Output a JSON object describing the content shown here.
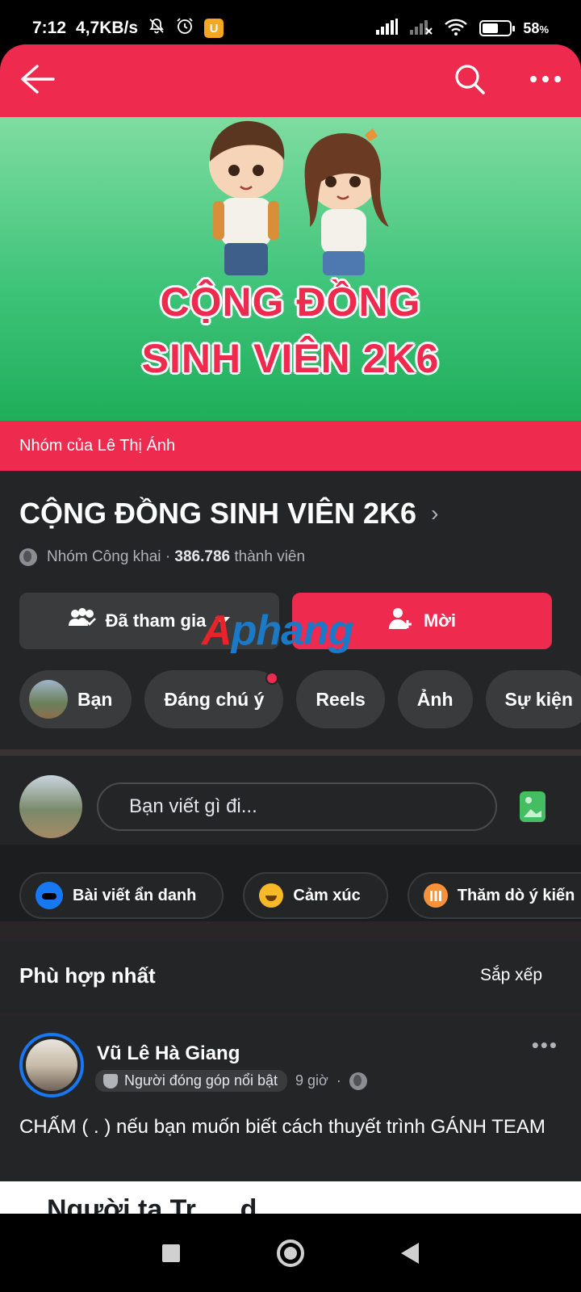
{
  "status_bar": {
    "time": "7:12",
    "speed": "4,7KB/s",
    "battery_percent": "58",
    "battery_unit": "%",
    "battery_level": 0.58,
    "icons": [
      "mute-bell-icon",
      "alarm-icon",
      "app-badge-icon",
      "signal-icon",
      "signal-off-icon",
      "wifi-icon",
      "battery-icon"
    ]
  },
  "header": {
    "back_icon": "arrow-left-icon",
    "search_icon": "search-icon",
    "more_icon": "more-horizontal-icon",
    "accent_color": "#ee2a4e"
  },
  "cover": {
    "line1": "CỘNG ĐỒNG",
    "line2": "SINH VIÊN 2K6"
  },
  "group": {
    "owner_label": "Nhóm của Lê Thị Ánh",
    "name": "CỘNG ĐỒNG SINH VIÊN 2K6",
    "privacy": "Nhóm Công khai",
    "separator": "·",
    "member_count": "386.786",
    "member_label": "thành viên",
    "joined_label": "Đã tham gia",
    "invite_label": "Mời"
  },
  "watermark": {
    "part_a": "A",
    "part_b": "phang"
  },
  "chips": [
    {
      "label": "Bạn"
    },
    {
      "label": "Đáng chú ý"
    },
    {
      "label": "Reels"
    },
    {
      "label": "Ảnh"
    },
    {
      "label": "Sự kiện"
    }
  ],
  "composer": {
    "placeholder": "Bạn viết gì đi...",
    "actions": [
      {
        "label": "Bài viết ẩn danh",
        "icon": "incognito-icon"
      },
      {
        "label": "Cảm xúc",
        "icon": "smile-icon"
      },
      {
        "label": "Thăm dò ý kiến",
        "icon": "poll-icon"
      }
    ]
  },
  "feed": {
    "sort_title": "Phù hợp nhất",
    "sort_button": "Sắp xếp"
  },
  "post": {
    "author": "Vũ Lê Hà Giang",
    "badge": "Người đóng góp nổi bật",
    "time": "9 giờ",
    "dot": "·",
    "text": "CHẤM ( . ) nếu bạn muốn biết cách thuyết trình GÁNH TEAM"
  },
  "next_preview": "Người ta Tr......d..."
}
